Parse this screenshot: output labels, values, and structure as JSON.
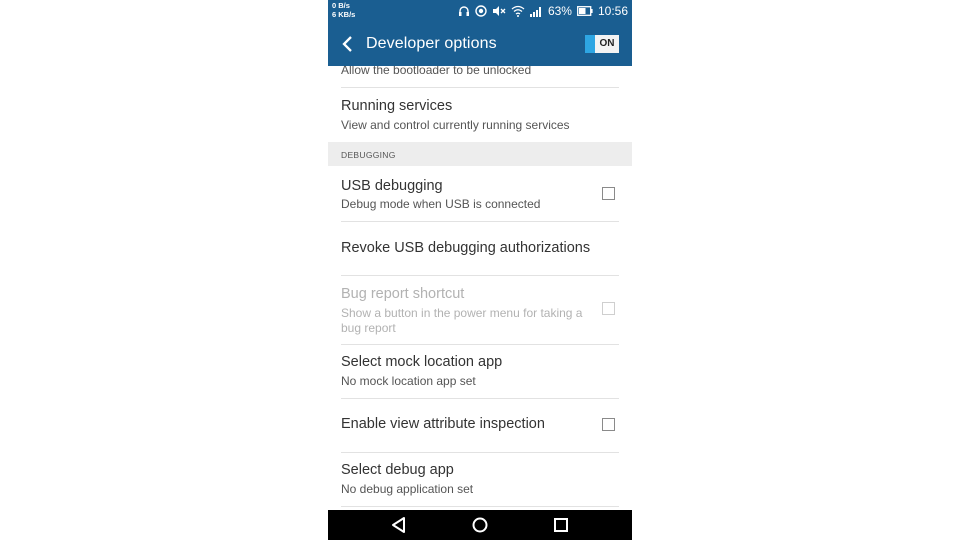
{
  "status_bar": {
    "net_up": "0 B/s",
    "net_down": "6 KB/s",
    "battery_percent": "63%",
    "time": "10:56",
    "icons": [
      "headphones-icon",
      "sync-icon",
      "mute-icon",
      "wifi-icon",
      "signal-icon",
      "battery-icon"
    ]
  },
  "app_bar": {
    "title": "Developer options",
    "toggle_label": "ON",
    "toggle_state": "on",
    "color": "#1a5e91",
    "toggle_color": "#2ea6e3"
  },
  "settings": {
    "partial_item_subtitle": "Allow the bootloader to be unlocked",
    "running_services": {
      "title": "Running services",
      "subtitle": "View and control currently running services"
    },
    "debugging_header": "DEBUGGING",
    "usb_debugging": {
      "title": "USB debugging",
      "subtitle": "Debug mode when USB is connected",
      "checked": false
    },
    "revoke_usb": {
      "title": "Revoke USB debugging authorizations"
    },
    "bug_report": {
      "title": "Bug report shortcut",
      "subtitle": "Show a button in the power menu for taking a bug report",
      "checked": false,
      "enabled": false
    },
    "mock_location": {
      "title": "Select mock location app",
      "subtitle": "No mock location app set"
    },
    "view_attribute": {
      "title": "Enable view attribute inspection",
      "checked": false
    },
    "debug_app": {
      "title": "Select debug app",
      "subtitle": "No debug application set"
    }
  },
  "nav_bar": {
    "icons": [
      "back-triangle-icon",
      "home-circle-icon",
      "recents-square-icon"
    ]
  }
}
